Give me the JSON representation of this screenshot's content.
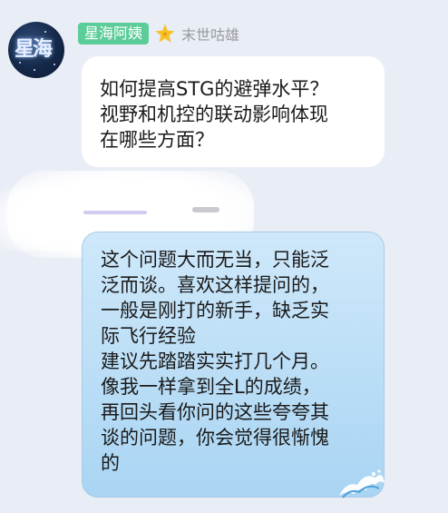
{
  "sender": {
    "avatar_text": "星海",
    "nickname": "星海阿姨",
    "title": "末世咕雄"
  },
  "message_question": {
    "lines": [
      "如何提高STG的避弹水平？",
      "视野和机控的联动影响体现",
      "在哪些方面？"
    ]
  },
  "message_reply": {
    "lines": [
      "这个问题大而无当，只能泛",
      "泛而谈。喜欢这样提问的，",
      "一般是刚打的新手，缺乏实",
      "际飞行经验",
      "建议先踏踏实实打几个月。",
      "像我一样拿到全L的成绩，",
      "再回头看你问的这些夸夸其",
      "谈的问题，你会觉得很惭愧",
      "的"
    ]
  },
  "colors": {
    "background": "#e9edf5",
    "badge": "#5ccc98",
    "reply_bubble": "#b8dcf6",
    "question_bubble": "#ffffff"
  }
}
